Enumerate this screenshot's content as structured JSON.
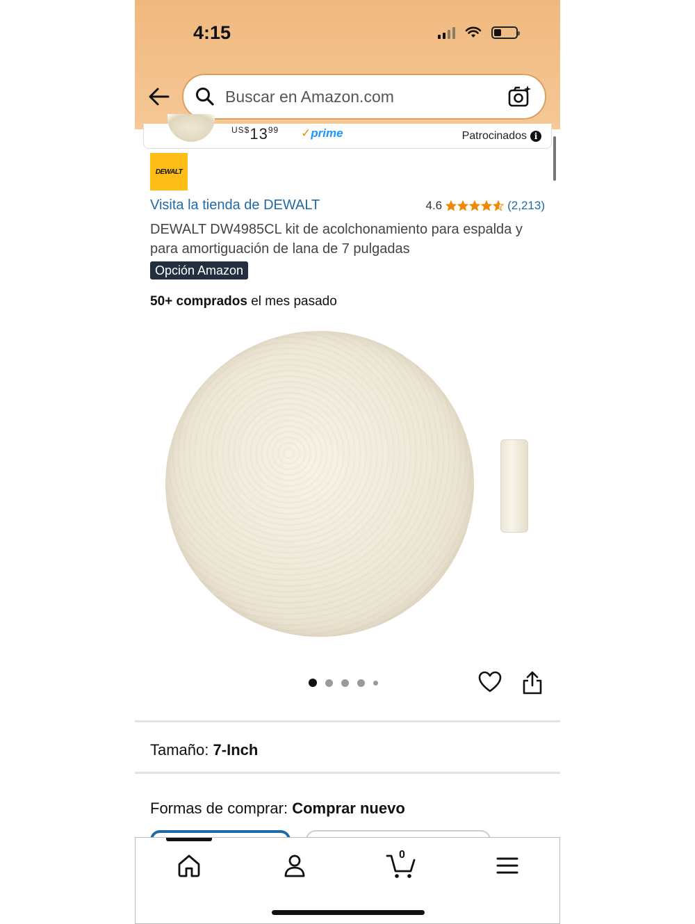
{
  "status_bar": {
    "time": "4:15"
  },
  "header": {
    "search_placeholder": "Buscar en Amazon.com"
  },
  "sponsored": {
    "price_prefix": "US$",
    "price_whole": "13",
    "price_fraction": "99",
    "prime_check": "✓",
    "prime_label": "prime",
    "label": "Patrocinados",
    "info_symbol": "i"
  },
  "product": {
    "brand_logo_text": "DEWALT",
    "store_link": "Visita la tienda de DEWALT",
    "rating_value": "4.6",
    "rating_stars": 4.6,
    "rating_count": "(2,213)",
    "title": "DEWALT DW4985CL kit de acolchonamiento para espalda y para amortiguación de lana de 7 pulgadas",
    "badge": "Opción Amazon",
    "bought_strong": "50+ comprados",
    "bought_rest": " el mes pasado"
  },
  "gallery": {
    "image_count": 5,
    "active_index": 0
  },
  "size": {
    "label": "Tamaño:",
    "value": "7-Inch"
  },
  "buying": {
    "label": "Formas de comprar:",
    "value": "Comprar nuevo"
  },
  "nav": {
    "cart_count": "0"
  },
  "colors": {
    "header_bg": "#f3c491",
    "link": "#1f6aa6",
    "star": "#f08804",
    "badge_bg": "#232f3e"
  }
}
